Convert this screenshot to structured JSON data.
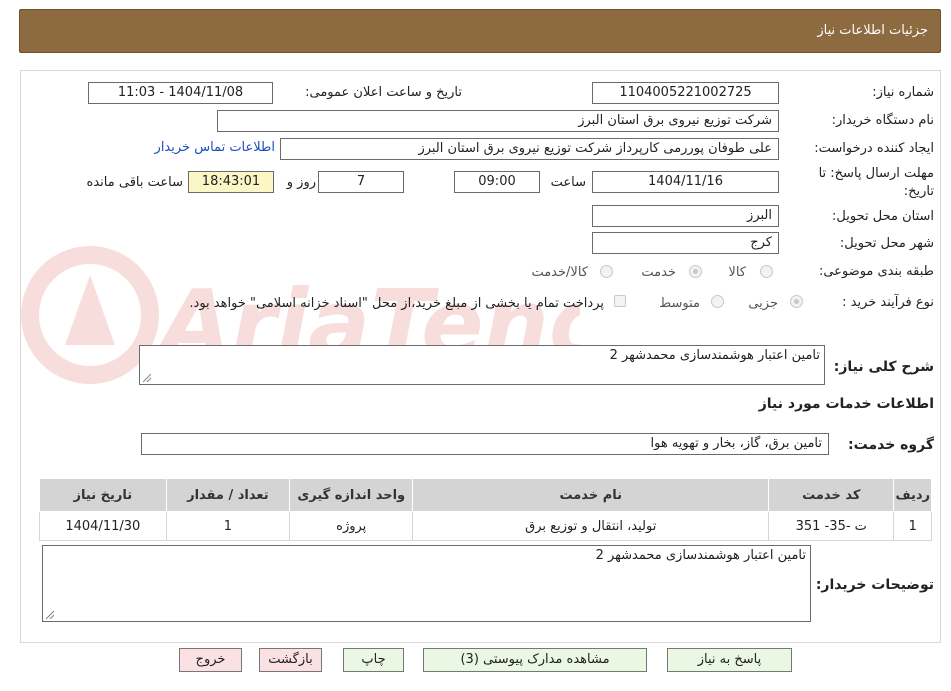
{
  "header": {
    "title": "جزئیات اطلاعات نیاز"
  },
  "form": {
    "need_number": {
      "label": "شماره نیاز:",
      "value": "1104005221002725"
    },
    "announce_datetime": {
      "label": "تاریخ و ساعت اعلان عمومی:",
      "value": "1404/11/08 - 11:03"
    },
    "buyer_org": {
      "label": "نام دستگاه خریدار:",
      "value": "شرکت توزیع نیروی برق استان البرز"
    },
    "requester": {
      "label": "ایجاد کننده درخواست:",
      "value": "علی طوفان پوررمی کارپرداز شرکت توزیع نیروی برق استان البرز"
    },
    "contact_link": "اطلاعات تماس خریدار",
    "deadline": {
      "label_line1": "مهلت ارسال پاسخ: تا",
      "label_line2": "تاریخ:",
      "date": "1404/11/16",
      "time_label": "ساعت",
      "time": "09:00",
      "days": "7",
      "days_label": "روز و",
      "remaining": "18:43:01",
      "remaining_label": "ساعت باقی مانده"
    },
    "province": {
      "label": "استان محل تحویل:",
      "value": "البرز"
    },
    "city": {
      "label": "شهر محل تحویل:",
      "value": "کرج"
    },
    "category": {
      "label": "طبقه بندی موضوعی:",
      "options": [
        "کالا",
        "خدمت",
        "کالا/خدمت"
      ],
      "selected": "خدمت"
    },
    "purchase_type": {
      "label": "نوع فرآیند خرید :",
      "options": [
        "جزیی",
        "متوسط"
      ],
      "selected": "جزیی",
      "treasury_note": "پرداخت تمام یا بخشی از مبلغ خرید،از محل \"اسناد خزانه اسلامی\" خواهد بود."
    },
    "description": {
      "label": "شرح کلی نیاز:",
      "value": "تامین اعتبار هوشمندسازی محمدشهر 2"
    }
  },
  "services": {
    "section_title": "اطلاعات خدمات مورد نیاز",
    "group_label": "گروه خدمت:",
    "group_value": "تامین برق، گاز، بخار و تهویه هوا",
    "columns": [
      "ردیف",
      "کد خدمت",
      "نام خدمت",
      "واحد اندازه گیری",
      "تعداد / مقدار",
      "تاریخ نیاز"
    ],
    "rows": [
      [
        "1",
        "ت -35- 351",
        "تولید، انتقال و توزیع برق",
        "پروژه",
        "1",
        "1404/11/30"
      ]
    ]
  },
  "buyer_notes": {
    "label": "توضیحات خریدار:",
    "value": "تامین اعتبار هوشمندسازی محمدشهر 2"
  },
  "buttons": {
    "reply": "پاسخ به نیاز",
    "attachments": "مشاهده مدارک پیوستی (3)",
    "print": "چاپ",
    "back": "بازگشت",
    "exit": "خروج"
  },
  "watermark": "AriaTender.neT",
  "colors": {
    "header_bg": "#8d6a3f",
    "link": "#1c4fbf",
    "button_green": "#eaf7e2",
    "button_pink": "#fbe0e4",
    "remaining_bg": "#fbf6c6"
  }
}
